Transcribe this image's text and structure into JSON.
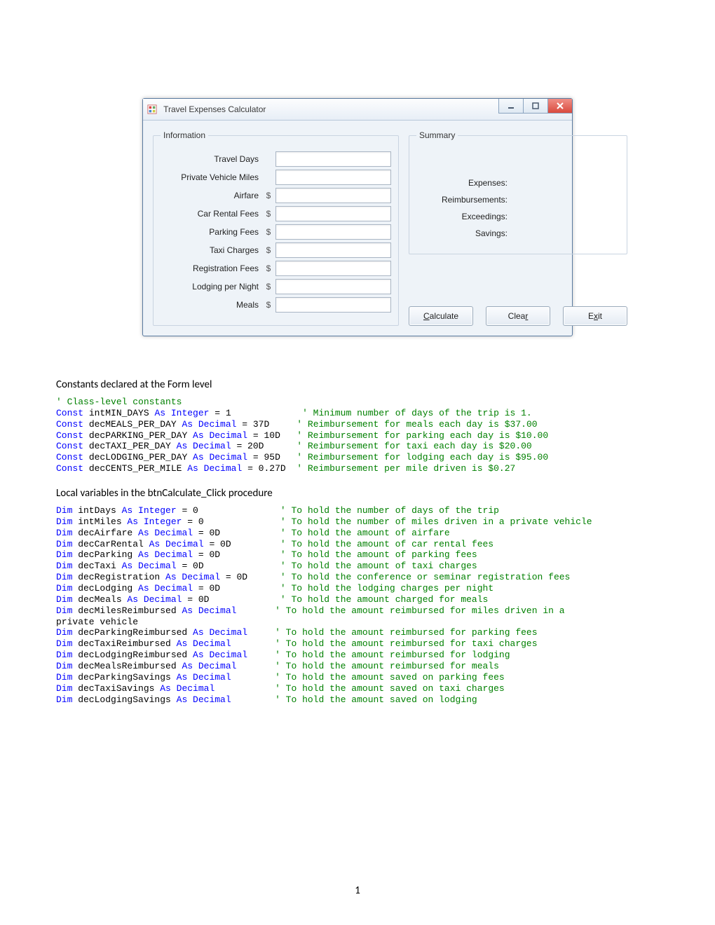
{
  "window": {
    "title": "Travel Expenses Calculator",
    "groupbox_info_legend": "Information",
    "groupbox_summary_legend": "Summary",
    "currency": "$",
    "info_fields": [
      {
        "label": "Travel Days",
        "has_currency": false,
        "value": ""
      },
      {
        "label": "Private Vehicle Miles",
        "has_currency": false,
        "value": ""
      },
      {
        "label": "Airfare",
        "has_currency": true,
        "value": ""
      },
      {
        "label": "Car Rental Fees",
        "has_currency": true,
        "value": ""
      },
      {
        "label": "Parking Fees",
        "has_currency": true,
        "value": ""
      },
      {
        "label": "Taxi Charges",
        "has_currency": true,
        "value": ""
      },
      {
        "label": "Registration Fees",
        "has_currency": true,
        "value": ""
      },
      {
        "label": "Lodging per Night",
        "has_currency": true,
        "value": ""
      },
      {
        "label": "Meals",
        "has_currency": true,
        "value": ""
      }
    ],
    "summary_rows": [
      {
        "label": "Expenses:",
        "value": ""
      },
      {
        "label": "Reimbursements:",
        "value": ""
      },
      {
        "label": "Exceedings:",
        "value": ""
      },
      {
        "label": "Savings:",
        "value": ""
      }
    ],
    "buttons": {
      "calculate": {
        "pre": "",
        "u": "C",
        "post": "alculate"
      },
      "clear": {
        "pre": "Clea",
        "u": "r",
        "post": ""
      },
      "exit": {
        "pre": "E",
        "u": "x",
        "post": "it"
      }
    }
  },
  "heading_constants": "Constants declared at the Form level",
  "constants_code_lines": [
    {
      "kw": "' Class-level constants",
      "body": "",
      "cm": "",
      "is_comment_only": true
    },
    {
      "kw": "Const",
      "name": " intMIN_DAYS ",
      "kw2": "As Integer",
      "tail": " = 1             ",
      "cm": "' Minimum number of days of the trip is 1."
    },
    {
      "kw": "Const",
      "name": " decMEALS_PER_DAY ",
      "kw2": "As Decimal",
      "tail": " = 37D     ",
      "cm": "' Reimbursement for meals each day is $37.00"
    },
    {
      "kw": "Const",
      "name": " decPARKING_PER_DAY ",
      "kw2": "As Decimal",
      "tail": " = 10D   ",
      "cm": "' Reimbursement for parking each day is $10.00"
    },
    {
      "kw": "Const",
      "name": " decTAXI_PER_DAY ",
      "kw2": "As Decimal",
      "tail": " = 20D      ",
      "cm": "' Reimbursement for taxi each day is $20.00"
    },
    {
      "kw": "Const",
      "name": " decLODGING_PER_DAY ",
      "kw2": "As Decimal",
      "tail": " = 95D   ",
      "cm": "' Reimbursement for lodging each day is $95.00"
    },
    {
      "kw": "Const",
      "name": " decCENTS_PER_MILE ",
      "kw2": "As Decimal",
      "tail": " = 0.27D  ",
      "cm": "' Reimbursement per mile driven is $0.27"
    }
  ],
  "heading_locals": " Local variables in the btnCalculate_Click procedure",
  "locals_code_lines": [
    {
      "kw": "Dim",
      "name": " intDays ",
      "kw2": "As Integer",
      "tail": " = 0               ",
      "cm": "' To hold the number of days of the trip"
    },
    {
      "kw": "Dim",
      "name": " intMiles ",
      "kw2": "As Integer",
      "tail": " = 0              ",
      "cm": "' To hold the number of miles driven in a private vehicle"
    },
    {
      "kw": "Dim",
      "name": " decAirfare ",
      "kw2": "As Decimal",
      "tail": " = 0D           ",
      "cm": "' To hold the amount of airfare"
    },
    {
      "kw": "Dim",
      "name": " decCarRental ",
      "kw2": "As Decimal",
      "tail": " = 0D         ",
      "cm": "' To hold the amount of car rental fees"
    },
    {
      "kw": "Dim",
      "name": " decParking ",
      "kw2": "As Decimal",
      "tail": " = 0D           ",
      "cm": "' To hold the amount of parking fees"
    },
    {
      "kw": "Dim",
      "name": " decTaxi ",
      "kw2": "As Decimal",
      "tail": " = 0D              ",
      "cm": "' To hold the amount of taxi charges"
    },
    {
      "kw": "Dim",
      "name": " decRegistration ",
      "kw2": "As Decimal",
      "tail": " = 0D      ",
      "cm": "' To hold the conference or seminar registration fees"
    },
    {
      "kw": "Dim",
      "name": " decLodging ",
      "kw2": "As Decimal",
      "tail": " = 0D           ",
      "cm": "' To hold the lodging charges per night"
    },
    {
      "kw": "Dim",
      "name": " decMeals ",
      "kw2": "As Decimal",
      "tail": " = 0D             ",
      "cm": "' To hold the amount charged for meals"
    },
    {
      "kw": "Dim",
      "name": " decMilesReimbursed ",
      "kw2": "As Decimal",
      "tail": "       ",
      "cm": "' To hold the amount reimbursed for miles driven in a "
    },
    {
      "wrap": true,
      "text": "private vehicle"
    },
    {
      "kw": "Dim",
      "name": " decParkingReimbursed ",
      "kw2": "As Decimal",
      "tail": "     ",
      "cm": "' To hold the amount reimbursed for parking fees"
    },
    {
      "kw": "Dim",
      "name": " decTaxiReimbursed ",
      "kw2": "As Decimal",
      "tail": "        ",
      "cm": "' To hold the amount reimbursed for taxi charges"
    },
    {
      "kw": "Dim",
      "name": " decLodgingReimbursed ",
      "kw2": "As Decimal",
      "tail": "     ",
      "cm": "' To hold the amount reimbursed for lodging"
    },
    {
      "kw": "Dim",
      "name": " decMealsReimbursed ",
      "kw2": "As Decimal",
      "tail": "       ",
      "cm": "' To hold the amount reimbursed for meals"
    },
    {
      "kw": "Dim",
      "name": " decParkingSavings ",
      "kw2": "As Decimal",
      "tail": "        ",
      "cm": "' To hold the amount saved on parking fees"
    },
    {
      "kw": "Dim",
      "name": " decTaxiSavings ",
      "kw2": "As Decimal",
      "tail": "           ",
      "cm": "' To hold the amount saved on taxi charges"
    },
    {
      "kw": "Dim",
      "name": " decLodgingSavings ",
      "kw2": "As Decimal",
      "tail": "        ",
      "cm": "' To hold the amount saved on lodging"
    }
  ],
  "page_number": "1"
}
